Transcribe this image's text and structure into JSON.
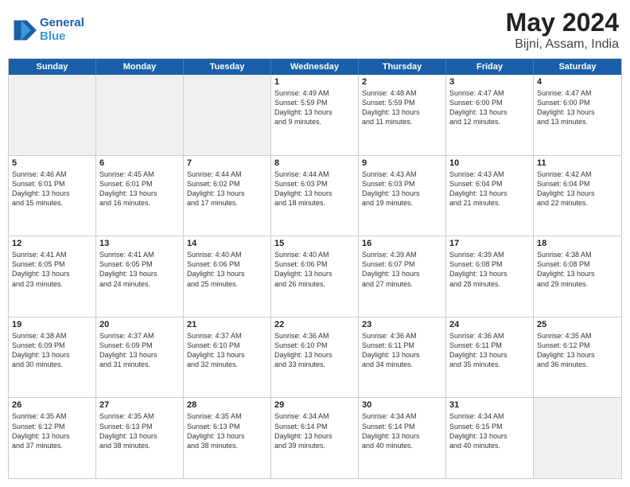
{
  "header": {
    "logo_line1": "General",
    "logo_line2": "Blue",
    "title": "May 2024",
    "location": "Bijni, Assam, India"
  },
  "weekdays": [
    "Sunday",
    "Monday",
    "Tuesday",
    "Wednesday",
    "Thursday",
    "Friday",
    "Saturday"
  ],
  "rows": [
    [
      {
        "day": "",
        "lines": [],
        "shaded": true
      },
      {
        "day": "",
        "lines": [],
        "shaded": true
      },
      {
        "day": "",
        "lines": [],
        "shaded": true
      },
      {
        "day": "1",
        "lines": [
          "Sunrise: 4:49 AM",
          "Sunset: 5:59 PM",
          "Daylight: 13 hours",
          "and 9 minutes."
        ]
      },
      {
        "day": "2",
        "lines": [
          "Sunrise: 4:48 AM",
          "Sunset: 5:59 PM",
          "Daylight: 13 hours",
          "and 11 minutes."
        ]
      },
      {
        "day": "3",
        "lines": [
          "Sunrise: 4:47 AM",
          "Sunset: 6:00 PM",
          "Daylight: 13 hours",
          "and 12 minutes."
        ]
      },
      {
        "day": "4",
        "lines": [
          "Sunrise: 4:47 AM",
          "Sunset: 6:00 PM",
          "Daylight: 13 hours",
          "and 13 minutes."
        ]
      }
    ],
    [
      {
        "day": "5",
        "lines": [
          "Sunrise: 4:46 AM",
          "Sunset: 6:01 PM",
          "Daylight: 13 hours",
          "and 15 minutes."
        ]
      },
      {
        "day": "6",
        "lines": [
          "Sunrise: 4:45 AM",
          "Sunset: 6:01 PM",
          "Daylight: 13 hours",
          "and 16 minutes."
        ]
      },
      {
        "day": "7",
        "lines": [
          "Sunrise: 4:44 AM",
          "Sunset: 6:02 PM",
          "Daylight: 13 hours",
          "and 17 minutes."
        ]
      },
      {
        "day": "8",
        "lines": [
          "Sunrise: 4:44 AM",
          "Sunset: 6:03 PM",
          "Daylight: 13 hours",
          "and 18 minutes."
        ]
      },
      {
        "day": "9",
        "lines": [
          "Sunrise: 4:43 AM",
          "Sunset: 6:03 PM",
          "Daylight: 13 hours",
          "and 19 minutes."
        ]
      },
      {
        "day": "10",
        "lines": [
          "Sunrise: 4:43 AM",
          "Sunset: 6:04 PM",
          "Daylight: 13 hours",
          "and 21 minutes."
        ]
      },
      {
        "day": "11",
        "lines": [
          "Sunrise: 4:42 AM",
          "Sunset: 6:04 PM",
          "Daylight: 13 hours",
          "and 22 minutes."
        ]
      }
    ],
    [
      {
        "day": "12",
        "lines": [
          "Sunrise: 4:41 AM",
          "Sunset: 6:05 PM",
          "Daylight: 13 hours",
          "and 23 minutes."
        ]
      },
      {
        "day": "13",
        "lines": [
          "Sunrise: 4:41 AM",
          "Sunset: 6:05 PM",
          "Daylight: 13 hours",
          "and 24 minutes."
        ]
      },
      {
        "day": "14",
        "lines": [
          "Sunrise: 4:40 AM",
          "Sunset: 6:06 PM",
          "Daylight: 13 hours",
          "and 25 minutes."
        ]
      },
      {
        "day": "15",
        "lines": [
          "Sunrise: 4:40 AM",
          "Sunset: 6:06 PM",
          "Daylight: 13 hours",
          "and 26 minutes."
        ]
      },
      {
        "day": "16",
        "lines": [
          "Sunrise: 4:39 AM",
          "Sunset: 6:07 PM",
          "Daylight: 13 hours",
          "and 27 minutes."
        ]
      },
      {
        "day": "17",
        "lines": [
          "Sunrise: 4:39 AM",
          "Sunset: 6:08 PM",
          "Daylight: 13 hours",
          "and 28 minutes."
        ]
      },
      {
        "day": "18",
        "lines": [
          "Sunrise: 4:38 AM",
          "Sunset: 6:08 PM",
          "Daylight: 13 hours",
          "and 29 minutes."
        ]
      }
    ],
    [
      {
        "day": "19",
        "lines": [
          "Sunrise: 4:38 AM",
          "Sunset: 6:09 PM",
          "Daylight: 13 hours",
          "and 30 minutes."
        ]
      },
      {
        "day": "20",
        "lines": [
          "Sunrise: 4:37 AM",
          "Sunset: 6:09 PM",
          "Daylight: 13 hours",
          "and 31 minutes."
        ]
      },
      {
        "day": "21",
        "lines": [
          "Sunrise: 4:37 AM",
          "Sunset: 6:10 PM",
          "Daylight: 13 hours",
          "and 32 minutes."
        ]
      },
      {
        "day": "22",
        "lines": [
          "Sunrise: 4:36 AM",
          "Sunset: 6:10 PM",
          "Daylight: 13 hours",
          "and 33 minutes."
        ]
      },
      {
        "day": "23",
        "lines": [
          "Sunrise: 4:36 AM",
          "Sunset: 6:11 PM",
          "Daylight: 13 hours",
          "and 34 minutes."
        ]
      },
      {
        "day": "24",
        "lines": [
          "Sunrise: 4:36 AM",
          "Sunset: 6:11 PM",
          "Daylight: 13 hours",
          "and 35 minutes."
        ]
      },
      {
        "day": "25",
        "lines": [
          "Sunrise: 4:35 AM",
          "Sunset: 6:12 PM",
          "Daylight: 13 hours",
          "and 36 minutes."
        ]
      }
    ],
    [
      {
        "day": "26",
        "lines": [
          "Sunrise: 4:35 AM",
          "Sunset: 6:12 PM",
          "Daylight: 13 hours",
          "and 37 minutes."
        ]
      },
      {
        "day": "27",
        "lines": [
          "Sunrise: 4:35 AM",
          "Sunset: 6:13 PM",
          "Daylight: 13 hours",
          "and 38 minutes."
        ]
      },
      {
        "day": "28",
        "lines": [
          "Sunrise: 4:35 AM",
          "Sunset: 6:13 PM",
          "Daylight: 13 hours",
          "and 38 minutes."
        ]
      },
      {
        "day": "29",
        "lines": [
          "Sunrise: 4:34 AM",
          "Sunset: 6:14 PM",
          "Daylight: 13 hours",
          "and 39 minutes."
        ]
      },
      {
        "day": "30",
        "lines": [
          "Sunrise: 4:34 AM",
          "Sunset: 6:14 PM",
          "Daylight: 13 hours",
          "and 40 minutes."
        ]
      },
      {
        "day": "31",
        "lines": [
          "Sunrise: 4:34 AM",
          "Sunset: 6:15 PM",
          "Daylight: 13 hours",
          "and 40 minutes."
        ]
      },
      {
        "day": "",
        "lines": [],
        "shaded": true
      }
    ]
  ]
}
